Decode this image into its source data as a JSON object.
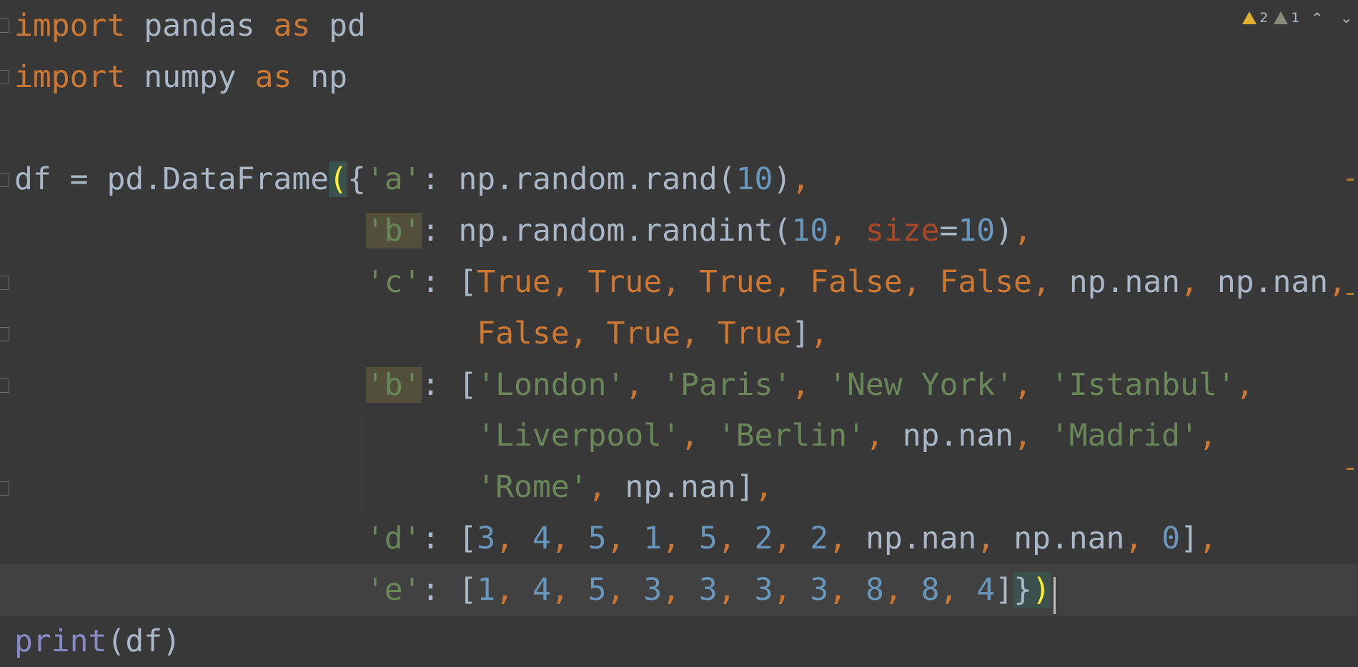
{
  "inspections": {
    "warnings_count": "2",
    "weak_warnings_count": "1",
    "prev_icon": "chevron-up-icon",
    "next_icon": "chevron-down-icon",
    "warning_color": "#e0b131"
  },
  "colors": {
    "background": "#383838",
    "current_line": "#414141",
    "keyword": "#cc7832",
    "string": "#6a8759",
    "number": "#6897bb",
    "identifier": "#a9b7c6",
    "builtin": "#8888c6",
    "kwarg": "#aa4926",
    "brace_match": "#ffef28"
  },
  "lines": [
    [
      [
        "import",
        "kw"
      ],
      [
        " pandas ",
        "plain"
      ],
      [
        "as",
        "kw"
      ],
      [
        " pd",
        "plain"
      ]
    ],
    [
      [
        "import",
        "kw"
      ],
      [
        " numpy ",
        "plain"
      ],
      [
        "as",
        "kw"
      ],
      [
        " np",
        "plain"
      ]
    ],
    [],
    [
      [
        "df = pd.DataFrame",
        "plain"
      ],
      [
        "(",
        "brace"
      ],
      [
        "{",
        "plain"
      ],
      [
        "'a'",
        "str"
      ],
      [
        ": np.random.rand(",
        "plain"
      ],
      [
        "10",
        "num"
      ],
      [
        ")",
        "plain"
      ],
      [
        ",",
        "comma"
      ]
    ],
    [
      [
        "                   ",
        "plain"
      ],
      [
        "'b'",
        "str dup"
      ],
      [
        ": np.random.randint(",
        "plain"
      ],
      [
        "10",
        "num"
      ],
      [
        ", ",
        "comma"
      ],
      [
        "size",
        "kwarg"
      ],
      [
        "=",
        "plain"
      ],
      [
        "10",
        "num"
      ],
      [
        ")",
        "plain"
      ],
      [
        ",",
        "comma"
      ]
    ],
    [
      [
        "                   ",
        "plain"
      ],
      [
        "'c'",
        "str"
      ],
      [
        ": [",
        "plain"
      ],
      [
        "True",
        "kw"
      ],
      [
        ", ",
        "comma"
      ],
      [
        "True",
        "kw"
      ],
      [
        ", ",
        "comma"
      ],
      [
        "True",
        "kw"
      ],
      [
        ", ",
        "comma"
      ],
      [
        "False",
        "kw"
      ],
      [
        ", ",
        "comma"
      ],
      [
        "False",
        "kw"
      ],
      [
        ", ",
        "comma"
      ],
      [
        "np.nan",
        "plain"
      ],
      [
        ", ",
        "comma"
      ],
      [
        "np.nan",
        "plain"
      ],
      [
        ",",
        "comma"
      ]
    ],
    [
      [
        "                         ",
        "plain"
      ],
      [
        "False",
        "kw"
      ],
      [
        ", ",
        "comma"
      ],
      [
        "True",
        "kw"
      ],
      [
        ", ",
        "comma"
      ],
      [
        "True",
        "kw"
      ],
      [
        "]",
        "plain"
      ],
      [
        ",",
        "comma"
      ]
    ],
    [
      [
        "                   ",
        "plain"
      ],
      [
        "'b'",
        "str dup"
      ],
      [
        ": [",
        "plain"
      ],
      [
        "'London'",
        "str"
      ],
      [
        ", ",
        "comma"
      ],
      [
        "'Paris'",
        "str"
      ],
      [
        ", ",
        "comma"
      ],
      [
        "'New York'",
        "str"
      ],
      [
        ", ",
        "comma"
      ],
      [
        "'Istanbul'",
        "str"
      ],
      [
        ",",
        "comma"
      ]
    ],
    [
      [
        "                         ",
        "plain"
      ],
      [
        "'Liverpool'",
        "str"
      ],
      [
        ", ",
        "comma"
      ],
      [
        "'Berlin'",
        "str"
      ],
      [
        ", ",
        "comma"
      ],
      [
        "np.nan",
        "plain"
      ],
      [
        ", ",
        "comma"
      ],
      [
        "'Madrid'",
        "str"
      ],
      [
        ",",
        "comma"
      ]
    ],
    [
      [
        "                         ",
        "plain"
      ],
      [
        "'Rome'",
        "str"
      ],
      [
        ", ",
        "comma"
      ],
      [
        "np.nan",
        "plain"
      ],
      [
        "]",
        "plain"
      ],
      [
        ",",
        "comma"
      ]
    ],
    [
      [
        "                   ",
        "plain"
      ],
      [
        "'d'",
        "str"
      ],
      [
        ": [",
        "plain"
      ],
      [
        "3",
        "num"
      ],
      [
        ", ",
        "comma"
      ],
      [
        "4",
        "num"
      ],
      [
        ", ",
        "comma"
      ],
      [
        "5",
        "num"
      ],
      [
        ", ",
        "comma"
      ],
      [
        "1",
        "num"
      ],
      [
        ", ",
        "comma"
      ],
      [
        "5",
        "num"
      ],
      [
        ", ",
        "comma"
      ],
      [
        "2",
        "num"
      ],
      [
        ", ",
        "comma"
      ],
      [
        "2",
        "num"
      ],
      [
        ", ",
        "comma"
      ],
      [
        "np.nan",
        "plain"
      ],
      [
        ", ",
        "comma"
      ],
      [
        "np.nan",
        "plain"
      ],
      [
        ", ",
        "comma"
      ],
      [
        "0",
        "num"
      ],
      [
        "]",
        "plain"
      ],
      [
        ",",
        "comma"
      ]
    ],
    [
      [
        "                   ",
        "plain"
      ],
      [
        "'e'",
        "str"
      ],
      [
        ": [",
        "plain"
      ],
      [
        "1",
        "num"
      ],
      [
        ", ",
        "comma"
      ],
      [
        "4",
        "num"
      ],
      [
        ", ",
        "comma"
      ],
      [
        "5",
        "num"
      ],
      [
        ", ",
        "comma"
      ],
      [
        "3",
        "num"
      ],
      [
        ", ",
        "comma"
      ],
      [
        "3",
        "num"
      ],
      [
        ", ",
        "comma"
      ],
      [
        "3",
        "num"
      ],
      [
        ", ",
        "comma"
      ],
      [
        "3",
        "num"
      ],
      [
        ", ",
        "comma"
      ],
      [
        "8",
        "num"
      ],
      [
        ", ",
        "comma"
      ],
      [
        "8",
        "num"
      ],
      [
        ", ",
        "comma"
      ],
      [
        "4",
        "num"
      ],
      [
        "]",
        "plain"
      ],
      [
        "}",
        "closebrace"
      ],
      [
        ")",
        "brace"
      ]
    ],
    [
      [
        "print",
        "builtin"
      ],
      [
        "(df)",
        "plain"
      ]
    ]
  ]
}
